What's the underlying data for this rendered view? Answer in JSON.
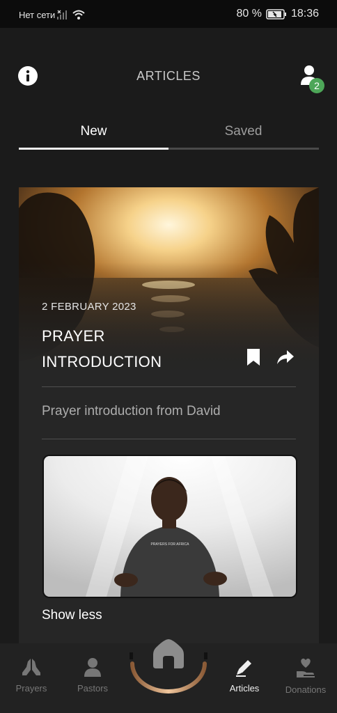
{
  "status_bar": {
    "carrier": "Нет сети",
    "battery": "80 %",
    "time": "18:36"
  },
  "header": {
    "title": "ARTICLES",
    "notification_count": "2"
  },
  "tabs": [
    {
      "label": "New",
      "active": true
    },
    {
      "label": "Saved",
      "active": false
    }
  ],
  "article": {
    "date": "2 FEBRUARY 2023",
    "title": "PRAYER INTRODUCTION",
    "description": "Prayer introduction from David",
    "video_shirt_text": "PRAYERS FOR AFRICA",
    "show_less_label": "Show less"
  },
  "bottom_nav": [
    {
      "label": "Prayers",
      "icon": "praying-hands-icon",
      "active": false
    },
    {
      "label": "Pastors",
      "icon": "person-icon",
      "active": false
    },
    {
      "label": "",
      "icon": "home-icon",
      "active": false
    },
    {
      "label": "Articles",
      "icon": "pencil-icon",
      "active": true
    },
    {
      "label": "Donations",
      "icon": "heart-hand-icon",
      "active": false
    }
  ],
  "colors": {
    "background": "#1b1b1b",
    "card": "#262626",
    "badge": "#4da658",
    "home_arc_accent": "#d9a77a"
  }
}
